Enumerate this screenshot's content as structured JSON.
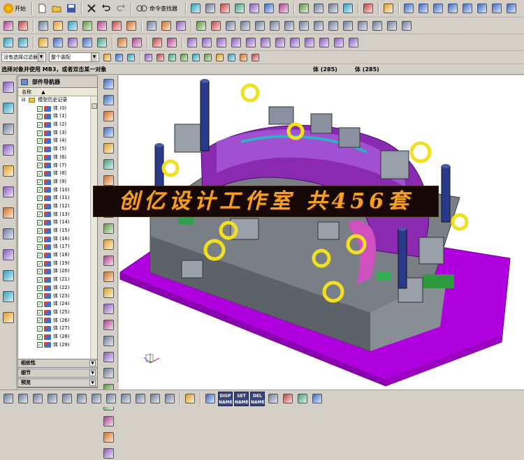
{
  "toolbar": {
    "start_label": "开始",
    "command_finder_label": "命令查找器",
    "row1_icons": [
      "new-file-icon",
      "open-folder-icon",
      "save-icon",
      "close-x-icon",
      "undo-icon",
      "redo-icon",
      "command-finder-icon",
      "sep",
      "select-icon",
      "zoom-icon",
      "shaded-cube-icon",
      "sphere-icon",
      "sep",
      "view-frame-icon",
      "sep",
      "arrow-icon",
      "sep",
      "plane-icon",
      "plane-icon",
      "plane-icon",
      "plane-icon",
      "plane-icon",
      "plane-icon",
      "plane-icon",
      "plane-icon"
    ],
    "row2_icons": [
      "sketch-icon",
      "box-icon",
      "sep",
      "sheet-icon",
      "revolve-icon",
      "extrude-icon",
      "cylinder-icon",
      "hole-icon",
      "boss-icon",
      "pocket-icon",
      "sep",
      "blend-icon",
      "chamfer-icon",
      "shell-icon",
      "sep",
      "trim-icon",
      "offset-icon",
      "face-icon",
      "face-icon",
      "face-icon",
      "face-icon",
      "face-icon",
      "face-icon",
      "face-icon",
      "face-icon",
      "face-icon",
      "face-icon",
      "face-icon",
      "face-icon",
      "face-icon"
    ],
    "row3_icons": [
      "layer-icon",
      "wcs-icon",
      "sep",
      "curve-icon",
      "arc-icon",
      "point-icon",
      "plane-icon",
      "datum-icon",
      "sep",
      "analysis-icon",
      "measure-icon",
      "sep",
      "move-icon",
      "edit-icon",
      "sep",
      "mold-icon",
      "mold-icon",
      "mold-icon",
      "mold-icon",
      "mold-icon",
      "mold-icon",
      "mold-icon",
      "mold-icon",
      "mold-icon",
      "mold-icon",
      "mold-icon",
      "mold-icon"
    ],
    "filter_value": "没有选择过滤器",
    "assembly_value": "整个装配",
    "snap_icons": [
      "rotate-icon",
      "face-select-icon",
      "body-select-icon",
      "sep",
      "snap-box-icon",
      "snap-grid-icon",
      "snap-line-icon",
      "snap-end-icon",
      "snap-mid-icon",
      "snap-center-icon",
      "snap-circle-icon",
      "snap-cross-icon",
      "snap-slash-icon",
      "snap-point-icon"
    ]
  },
  "status": {
    "prompt": "选择对象并使用 MB3，或者双击某一对象",
    "selected": "体 (285)"
  },
  "resource_bar": {
    "icons": [
      "assembly-navigator-icon",
      "constraint-navigator-icon",
      "part-navigator-icon",
      "reuse-library-icon",
      "hd3d-icon",
      "history-icon",
      "system-materials-icon",
      "palette-icon",
      "process-studio-icon",
      "roles-icon",
      "web-browser-icon",
      "print-icon"
    ]
  },
  "navigator": {
    "title": "部件导航器",
    "column_header": "名称",
    "root_label": "模型历史记录",
    "items": [
      "体 (0)",
      "体 (1)",
      "体 (2)",
      "体 (3)",
      "体 (4)",
      "体 (5)",
      "体 (6)",
      "体 (7)",
      "体 (8)",
      "体 (9)",
      "体 (10)",
      "体 (11)",
      "体 (12)",
      "体 (13)",
      "体 (14)",
      "体 (15)",
      "体 (16)",
      "体 (17)",
      "体 (18)",
      "体 (19)",
      "体 (20)",
      "体 (21)",
      "体 (22)",
      "体 (23)",
      "体 (24)",
      "体 (25)",
      "体 (26)",
      "体 (27)",
      "体 (28)",
      "体 (29)"
    ],
    "panels": [
      "相依性",
      "细节",
      "预览"
    ]
  },
  "mid_toolbar": {
    "icons": [
      "push-pull-icon",
      "offset-region-icon",
      "replace-face-icon",
      "resize-icon",
      "delete-face-icon",
      "move-face-icon",
      "pattern-face-icon",
      "mirror-face-icon",
      "copy-face-icon",
      "cut-face-icon",
      "paste-face-icon",
      "label-icon",
      "check-icon",
      "relate-icon",
      "dimension-icon",
      "linear-dim-icon",
      "angular-dim-icon",
      "radial-dim-icon",
      "group-face-icon",
      "edit-section-icon",
      "replace-icon",
      "label-icon",
      "check-icon",
      "undo-icon"
    ]
  },
  "viewport": {
    "banner_text": "创亿设计工作室 共456套"
  },
  "bottom_bar": {
    "icons": [
      "view-icon",
      "view-icon",
      "view-icon",
      "view-icon",
      "view-icon",
      "view-icon",
      "view-icon",
      "view-icon",
      "view-icon",
      "view-icon",
      "view-icon",
      "view-icon",
      "sep",
      "refresh-icon",
      "sep",
      "play-icon"
    ],
    "word_buttons": [
      {
        "top": "DISP",
        "bottom": "NAME"
      },
      {
        "top": "SET",
        "bottom": "NAME"
      },
      {
        "top": "DEL",
        "bottom": "NAME"
      }
    ],
    "right_icons": [
      "view-eye-icon",
      "pin-icon",
      "pen-icon",
      "arrow-right-icon"
    ]
  },
  "colors": {
    "platform": "#b000e0",
    "mold_base": "#7a7f86",
    "eyebolt": "#f0e020",
    "cavity": "#8a2ab0",
    "guide_pillar": "#2a3a8a",
    "banner_text": "#f4a020"
  }
}
